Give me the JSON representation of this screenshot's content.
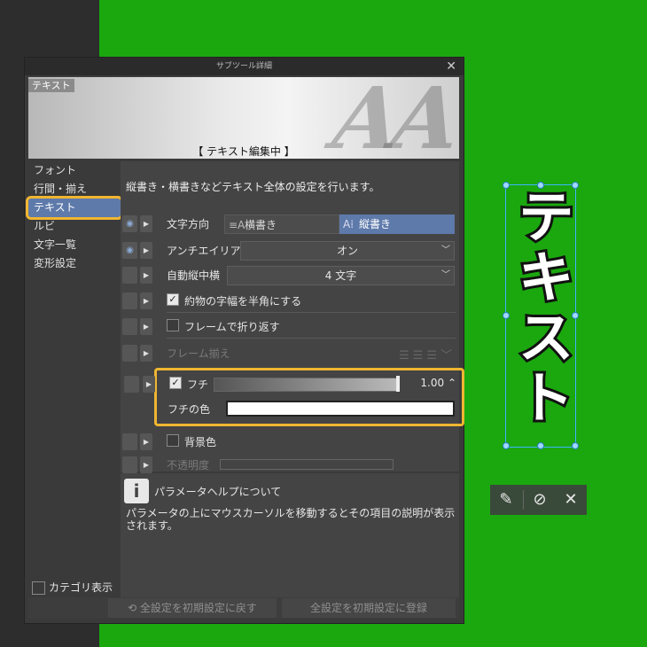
{
  "dialog": {
    "title": "サブツール詳細",
    "close_glyph": "✕",
    "preview_tag": "テキスト",
    "preview_letters": "AA",
    "preview_status": "【 テキスト編集中 】"
  },
  "categories": [
    {
      "label": "フォント",
      "selected": false
    },
    {
      "label": "行間・揃え",
      "selected": false
    },
    {
      "label": "テキスト",
      "selected": true
    },
    {
      "label": "ルビ",
      "selected": false
    },
    {
      "label": "文字一覧",
      "selected": false
    },
    {
      "label": "変形設定",
      "selected": false
    }
  ],
  "settings": {
    "description": "縦書き・横書きなどテキスト全体の設定を行います。",
    "direction": {
      "label": "文字方向",
      "horizontal": "横書き",
      "vertical": "縦書き",
      "selected": "vertical"
    },
    "antialias": {
      "label": "アンチエイリアス",
      "value": "オン"
    },
    "auto_tcy": {
      "label": "自動縦中横",
      "value": "4 文字"
    },
    "halfwidth": {
      "label": "約物の字幅を半角にする",
      "checked": true
    },
    "wrap": {
      "label": "フレームで折り返す",
      "checked": false
    },
    "frame_align": {
      "label": "フレーム揃え"
    },
    "fuchi": {
      "label": "フチ",
      "checked": true,
      "value": "1.00",
      "value_ratio": 1.0
    },
    "fuchi_color": {
      "label": "フチの色",
      "color": "#ffffff"
    },
    "bg_color": {
      "label": "背景色",
      "checked": false
    },
    "opacity": {
      "label": "不透明度"
    }
  },
  "help": {
    "icon": "i",
    "title": "パラメータヘルプについて",
    "text": "パラメータの上にマウスカーソルを移動するとその項目の説明が表示されます。"
  },
  "category_show": "カテゴリ表示",
  "footer": {
    "reset": "全設定を初期設定に戻す",
    "register": "全設定を初期設定に登録"
  },
  "canvas": {
    "text": "テキスト"
  },
  "mini_toolbar": {
    "pen": "✎",
    "confirm": "⊘",
    "cancel": "✕"
  },
  "colors": {
    "accent": "#5e7aab",
    "highlight": "#f0b631",
    "canvas_bg": "#1aa80e"
  }
}
